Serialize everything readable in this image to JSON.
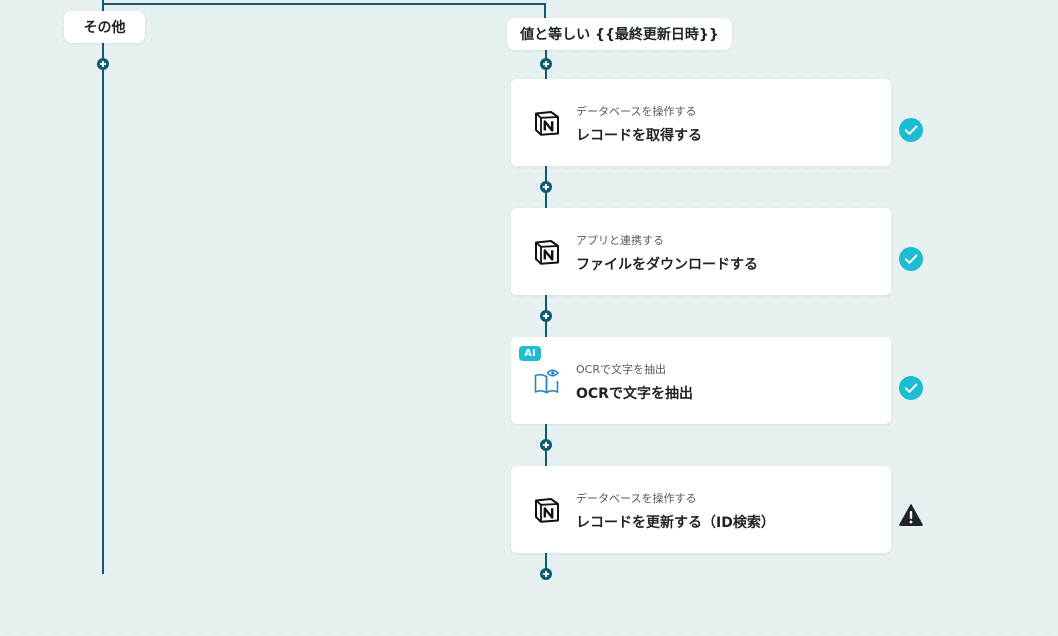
{
  "branches": {
    "other_label": "その他",
    "condition_label": "値と等しい {{最終更新日時}}"
  },
  "steps": [
    {
      "app": "notion",
      "icon": "notion-icon",
      "subtitle": "データベースを操作する",
      "title": "レコードを取得する",
      "status": "complete",
      "status_icon": "check-circle-icon"
    },
    {
      "app": "notion",
      "icon": "notion-icon",
      "subtitle": "アプリと連携する",
      "title": "ファイルをダウンロードする",
      "status": "complete",
      "status_icon": "check-circle-icon"
    },
    {
      "app": "ocr",
      "icon": "book-eye-icon",
      "badge": "AI",
      "subtitle": "OCRで文字を抽出",
      "title": "OCRで文字を抽出",
      "status": "complete",
      "status_icon": "check-circle-icon"
    },
    {
      "app": "notion",
      "icon": "notion-icon",
      "subtitle": "データベースを操作する",
      "title": "レコードを更新する（ID検索）",
      "status": "warning",
      "status_icon": "warning-triangle-icon"
    }
  ],
  "colors": {
    "connector": "#0d5c73",
    "complete": "#1dbcd1",
    "warning": "#1f2328",
    "background": "#e8f1f2"
  }
}
